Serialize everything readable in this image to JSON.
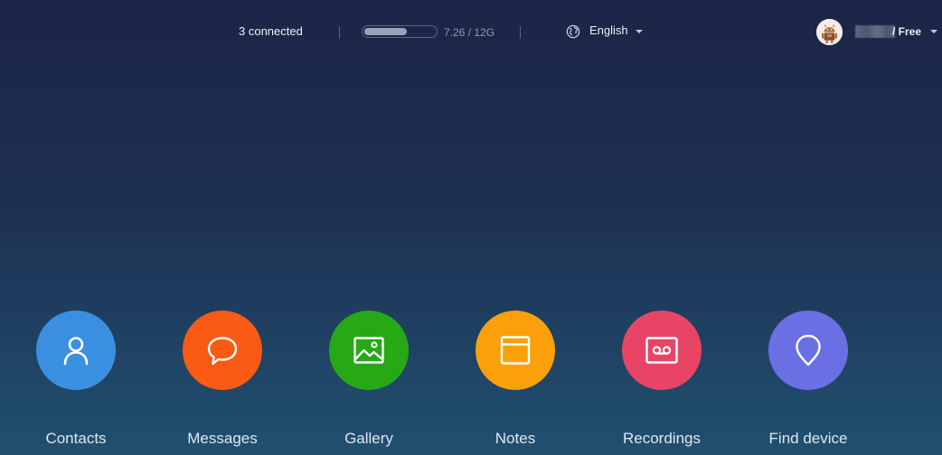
{
  "topbar": {
    "connected_text": "3 connected",
    "storage": {
      "used_fraction": 0.605,
      "text": "7.26 / 12G"
    },
    "language": {
      "selected": "English",
      "icon": "globe-icon"
    },
    "user": {
      "avatar_icon": "android-avatar-icon",
      "plan": "/ Free"
    }
  },
  "apps": [
    {
      "label": "Contacts",
      "icon": "person-icon",
      "color": "#3a8fe0"
    },
    {
      "label": "Messages",
      "icon": "chat-bubble-icon",
      "color": "#fa5a14"
    },
    {
      "label": "Gallery",
      "icon": "image-icon",
      "color": "#26a915"
    },
    {
      "label": "Notes",
      "icon": "note-icon",
      "color": "#fba00a"
    },
    {
      "label": "Recordings",
      "icon": "recorder-icon",
      "color": "#e84566"
    },
    {
      "label": "Find device",
      "icon": "location-pin-icon",
      "color": "#6a6fe4"
    }
  ]
}
